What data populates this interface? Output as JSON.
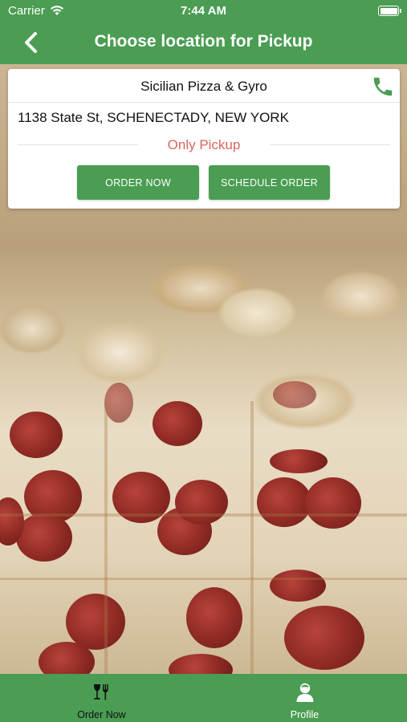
{
  "status_bar": {
    "carrier": "Carrier",
    "time": "7:44 AM",
    "wifi_icon": "wifi-icon",
    "battery_icon": "battery-icon"
  },
  "nav": {
    "back_icon": "chevron-left-icon",
    "title": "Choose location for Pickup"
  },
  "location_card": {
    "store_name": "Sicilian Pizza & Gyro",
    "phone_icon": "phone-icon",
    "address": "1138 State St, SCHENECTADY, NEW YORK",
    "pickup_type": "Only Pickup",
    "order_now_label": "ORDER NOW",
    "schedule_order_label": "SCHEDULE ORDER"
  },
  "tab_bar": {
    "tabs": [
      {
        "label": "Order Now",
        "icon": "utensils-icon"
      },
      {
        "label": "Profile",
        "icon": "user-icon"
      }
    ]
  },
  "colors": {
    "brand_green": "#4a9d52",
    "pickup_red": "#d9665e",
    "card_bg": "#ffffff"
  }
}
